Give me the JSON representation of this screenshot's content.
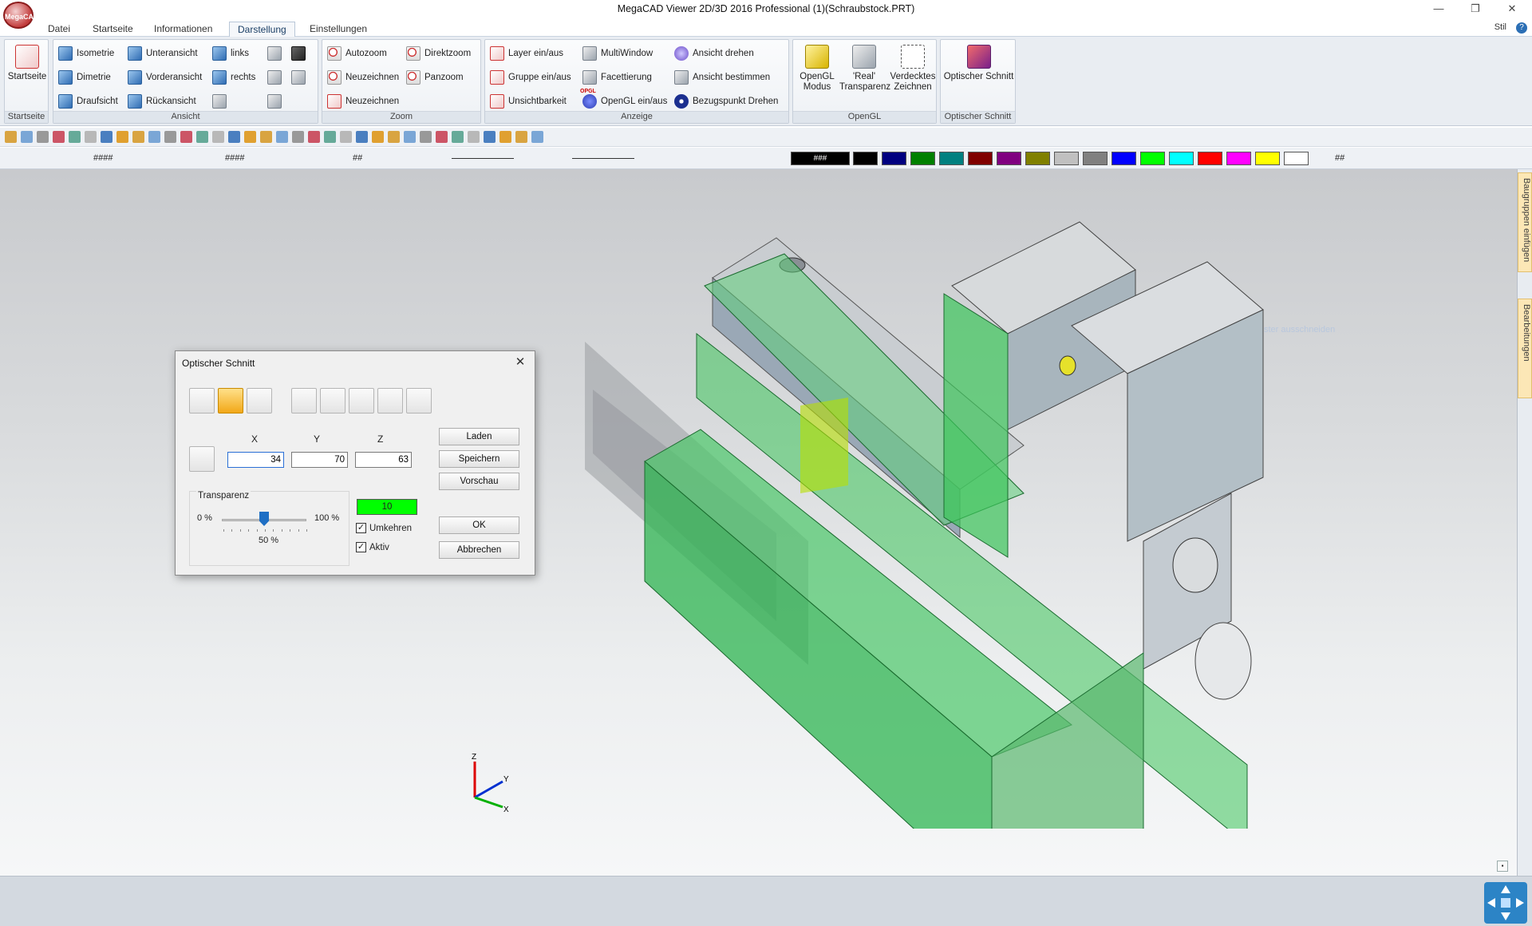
{
  "window": {
    "title": "MegaCAD Viewer 2D/3D 2016 Professional (1)(Schraubstock.PRT)",
    "logo_text": "MegaCAD",
    "minimize": "—",
    "maximize": "❐",
    "close": "✕"
  },
  "menu": {
    "tabs": [
      "Datei",
      "Startseite",
      "Informationen",
      "Darstellung",
      "Einstellungen"
    ],
    "active": "Darstellung",
    "style_label": "Stil",
    "help_icon": "?"
  },
  "ribbon": {
    "startseite": {
      "button": "Startseite",
      "group": "Startseite"
    },
    "ansicht": {
      "group": "Ansicht",
      "col1": [
        "Isometrie",
        "Dimetrie",
        "Draufsicht"
      ],
      "col2": [
        "Unteransicht",
        "Vorderansicht",
        "Rückansicht"
      ],
      "col3": [
        "links",
        "rechts"
      ]
    },
    "zoom": {
      "group": "Zoom",
      "col1": [
        "Autozoom",
        "Neuzeichnen",
        "Neuzeichnen"
      ],
      "col2": [
        "Direktzoom",
        "Panzoom"
      ]
    },
    "anzeige": {
      "group": "Anzeige",
      "col1": [
        "Layer ein/aus",
        "Gruppe ein/aus",
        "Unsichtbarkeit"
      ],
      "col2": [
        "MultiWindow",
        "Facettierung",
        "OpenGL ein/aus"
      ],
      "col3": [
        "Ansicht drehen",
        "Ansicht bestimmen",
        "Bezugspunkt Drehen"
      ],
      "opgl_label": "OPGL"
    },
    "opengl": {
      "group": "OpenGL",
      "b1": "OpenGL Modus",
      "b2": "'Real' Transparenz",
      "b3": "Verdecktes Zeichnen"
    },
    "optischer": {
      "group": "Optischer Schnitt",
      "b1": "Optischer Schnitt"
    }
  },
  "toolbar2": {
    "field1": "####",
    "field2": "####",
    "field3": "##",
    "color_label": "###",
    "end_label": "##",
    "colors": [
      "#000000",
      "#000080",
      "#008000",
      "#008080",
      "#800000",
      "#800080",
      "#808000",
      "#c0c0c0",
      "#808080",
      "#0000ff",
      "#00ff00",
      "#00ffff",
      "#ff0000",
      "#ff00ff",
      "#ffff00",
      "#ffffff"
    ]
  },
  "sidebar": {
    "tab1": "Baugruppen einfügen",
    "tab2": "Bearbeitungen"
  },
  "canvas": {
    "ghost_hint": "Fenster ausschneiden",
    "axes": {
      "x": "X",
      "y": "Y",
      "z": "Z"
    }
  },
  "dialog": {
    "title": "Optischer Schnitt",
    "labels": {
      "x": "X",
      "y": "Y",
      "z": "Z"
    },
    "values": {
      "x": "34",
      "y": "70",
      "z": "63"
    },
    "buttons": {
      "load": "Laden",
      "save": "Speichern",
      "preview": "Vorschau",
      "ok": "OK",
      "cancel": "Abbrechen"
    },
    "transparency": {
      "title": "Transparenz",
      "min": "0 %",
      "max": "100 %",
      "value_label": "50 %",
      "value_fraction": 0.5
    },
    "color_value": "10",
    "color_hex": "#00ff00",
    "invert": {
      "label": "Umkehren",
      "checked": true
    },
    "active": {
      "label": "Aktiv",
      "checked": true
    }
  }
}
